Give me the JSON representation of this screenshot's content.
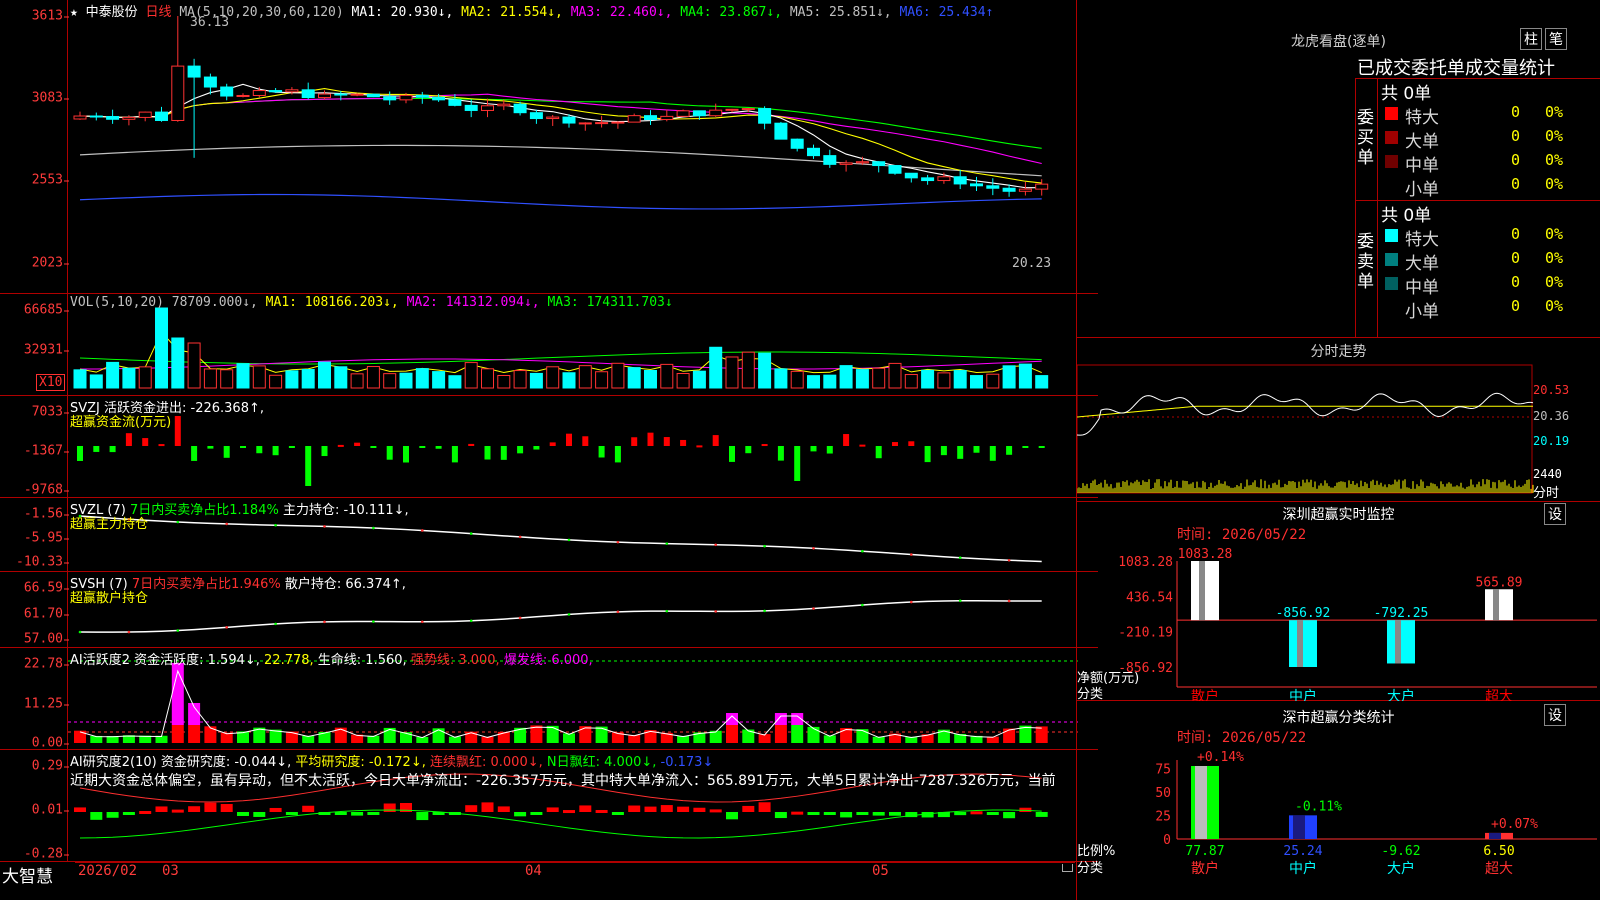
{
  "stock": {
    "name": "中泰股份",
    "period": "日线"
  },
  "kline": {
    "ma_params": "MA(5,10,20,30,60,120)",
    "ma_values": [
      {
        "label": "MA1: 20.930↓,",
        "color": "#ffffff"
      },
      {
        "label": "MA2: 21.554↓,",
        "color": "#ffff00"
      },
      {
        "label": "MA3: 22.460↓,",
        "color": "#ff00ff"
      },
      {
        "label": "MA4: 23.867↓,",
        "color": "#00ff00"
      },
      {
        "label": "MA5: 25.851↓,",
        "color": "#c0c0c0"
      },
      {
        "label": "MA6: 25.434↑",
        "color": "#3050ff"
      }
    ],
    "yticks": [
      "3613",
      "3083",
      "2553",
      "2023"
    ],
    "high_label": "36.13",
    "low_label": "20.23"
  },
  "vol": {
    "params": "VOL(5,10,20)",
    "values": [
      {
        "label": "78709.000↓,",
        "color": "#c0c0c0"
      },
      {
        "label": "MA1: 108166.203↓,",
        "color": "#ffff00"
      },
      {
        "label": "MA2: 141312.094↓,",
        "color": "#ff00ff"
      },
      {
        "label": "MA3: 174311.703↓",
        "color": "#00ff00"
      }
    ],
    "yticks": [
      "66685",
      "32931"
    ],
    "unit": "X10"
  },
  "svzj": {
    "header": "SVZJ  活跃资金进出: -226.368↑,",
    "subtitle": "超赢资金流(万元)",
    "yticks": [
      "7033",
      "-1367",
      "-9768"
    ]
  },
  "svzl": {
    "header_a": "SVZL (7)",
    "header_b": "7日内买卖净占比1.184%",
    "header_c": "主力持仓: -10.111↓,",
    "subtitle": "超赢主力持仓",
    "yticks": [
      "-1.56",
      "-5.95",
      "-10.33"
    ]
  },
  "svsh": {
    "header_a": "SVSH (7)",
    "header_b": "7日内买卖净占比1.946%",
    "header_c": "散户持仓: 66.374↑,",
    "subtitle": "超赢散户持仓",
    "yticks": [
      "66.59",
      "61.70",
      "57.00"
    ]
  },
  "ai1": {
    "header_a": "AI活跃度2 资金活跃度: 1.594↓,",
    "header_b": "22.778,",
    "header_c": "生命线: 1.560,",
    "header_d": "强势线: 3.000,",
    "header_e": "爆发线: 6.000,",
    "yticks": [
      "22.78",
      "11.25",
      "0.00"
    ]
  },
  "ai2": {
    "header_a": "AI研究度2(10) 资金研究度: -0.044↓,",
    "header_b": "平均研究度: -0.172↓,",
    "header_c": "连续飘红: 0.000↓,",
    "header_d": "N日飘红: 4.000↓,",
    "header_e": "-0.173↓",
    "comment": "近期大资金总体偏空，虽有异动，但不太活跃，今日大单净流出：-226.357万元，其中特大单净流入：565.891万元，大单5日累计净出-7287.326万元，当前",
    "yticks": [
      "0.29",
      "0.01",
      "-0.28"
    ]
  },
  "xaxis": {
    "labels": [
      "2026/02",
      "03",
      "04",
      "05"
    ]
  },
  "brand": "大智慧",
  "dragon": {
    "title": "龙虎看盘(逐单)",
    "btn1": "柱",
    "btn2": "笔",
    "tabs": "已成交委托单成交量统计",
    "buy_side": "委买单",
    "sell_side": "委卖单",
    "buy_count": "共 0单",
    "sell_count": "共 0单",
    "buy_rows": [
      {
        "label": "特大",
        "val": "0",
        "pct": "0%",
        "color": "#ff0000"
      },
      {
        "label": "大单",
        "val": "0",
        "pct": "0%",
        "color": "#a00000"
      },
      {
        "label": "中单",
        "val": "0",
        "pct": "0%",
        "color": "#700000"
      },
      {
        "label": "小单",
        "val": "0",
        "pct": "0%",
        "color": "#000000"
      }
    ],
    "sell_rows": [
      {
        "label": "特大",
        "val": "0",
        "pct": "0%",
        "color": "#00ffff"
      },
      {
        "label": "大单",
        "val": "0",
        "pct": "0%",
        "color": "#008080"
      },
      {
        "label": "中单",
        "val": "0",
        "pct": "0%",
        "color": "#006060"
      },
      {
        "label": "小单",
        "val": "0",
        "pct": "0%",
        "color": "#000000"
      }
    ]
  },
  "intraday": {
    "title": "分时走势",
    "ticks": [
      "20.53",
      "20.36",
      "20.19"
    ],
    "vol_label": "2440",
    "unit_label": "分时"
  },
  "monitor": {
    "title": "深圳超赢实时监控",
    "btn": "设",
    "time": "时间: 2026/05/22",
    "yticks": [
      "1083.28",
      "436.54",
      "-210.19",
      "-856.92"
    ],
    "ylabel": "净额(万元)",
    "xlabel": "分类",
    "bars": [
      {
        "label": "散户",
        "value": 1083.28,
        "text": "1083.28",
        "color": "#ffffff",
        "lcolor": "#ff0000"
      },
      {
        "label": "中户",
        "value": -856.92,
        "text": "-856.92",
        "color": "#00ffff",
        "lcolor": "#00ffff"
      },
      {
        "label": "大户",
        "value": -792.25,
        "text": "-792.25",
        "color": "#00ffff",
        "lcolor": "#00ffff"
      },
      {
        "label": "超大",
        "value": 565.89,
        "text": "565.89",
        "color": "#ffffff",
        "lcolor": "#ff0000"
      }
    ]
  },
  "category": {
    "title": "深市超赢分类统计",
    "btn": "设",
    "time": "时间: 2026/05/22",
    "yticks": [
      "75",
      "50",
      "25",
      "0"
    ],
    "ylabel": "比例%",
    "xlabel": "分类",
    "bars": [
      {
        "label": "散户",
        "value": 77.87,
        "text": "77.87",
        "delta": "+0.14%",
        "color": "#00ff00",
        "dcolor": "#ff3030"
      },
      {
        "label": "中户",
        "value": 25.24,
        "text": "25.24",
        "delta": "-0.11%",
        "color": "#2040ff",
        "dcolor": "#00ff00"
      },
      {
        "label": "大户",
        "value": -9.62,
        "text": "-9.62",
        "delta": "",
        "color": "#2040ff",
        "dcolor": "#00ff00"
      },
      {
        "label": "超大",
        "value": 6.5,
        "text": "6.50",
        "delta": "+0.07%",
        "color": "#ff3030",
        "dcolor": "#ff3030"
      }
    ]
  },
  "colors": {
    "up": "#ff3232",
    "down": "#00ffff",
    "grid": "#b00000"
  }
}
